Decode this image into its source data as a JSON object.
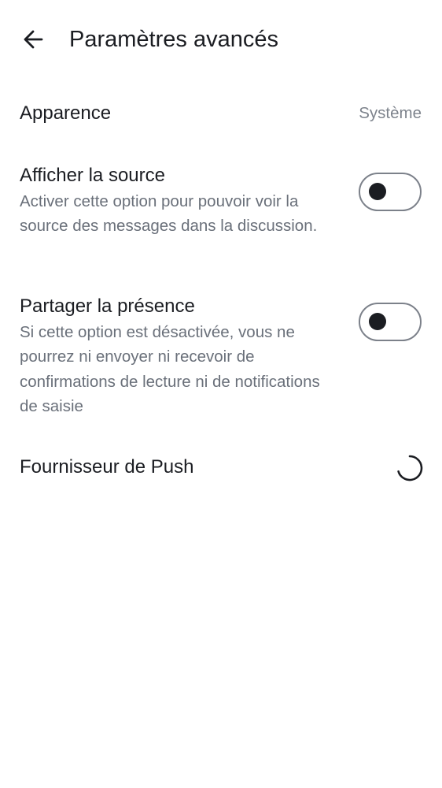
{
  "header": {
    "title": "Paramètres avancés",
    "back_icon": "arrow-left-icon"
  },
  "settings": {
    "appearance": {
      "label": "Apparence",
      "value": "Système"
    },
    "show_source": {
      "label": "Afficher la source",
      "description": "Activer cette option pour pouvoir voir la source des messages dans la discussion.",
      "enabled": false
    },
    "share_presence": {
      "label": "Partager la présence",
      "description": "Si cette option est désactivée, vous ne pourrez ni envoyer ni recevoir de confirmations de lecture ni de notifications de saisie",
      "enabled": false
    },
    "push_provider": {
      "label": "Fournisseur de Push",
      "status_icon": "loading-spinner-icon"
    }
  },
  "colors": {
    "text_primary": "#1b1d22",
    "text_secondary": "#6a707a",
    "toggle_border": "#7c818a",
    "background": "#ffffff"
  }
}
